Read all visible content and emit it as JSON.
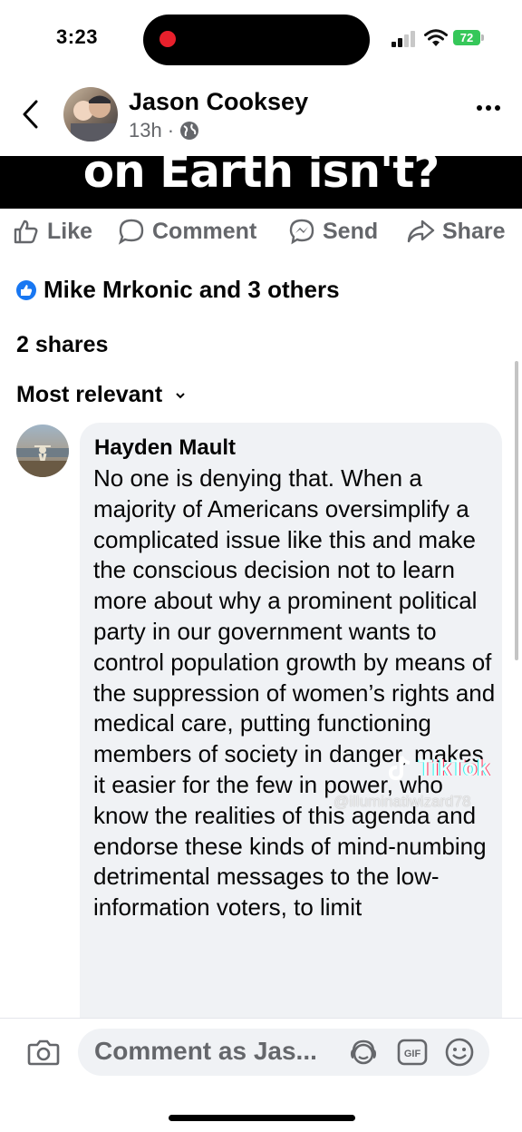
{
  "status_bar": {
    "time": "3:23",
    "battery": "72"
  },
  "header": {
    "author": "Jason Cooksey",
    "time_ago": "13h",
    "separator": "·"
  },
  "post_image": {
    "caption": "on Earth isn't?"
  },
  "actions": {
    "like": "Like",
    "comment": "Comment",
    "send": "Send",
    "share": "Share"
  },
  "engagement": {
    "reactions": "Mike Mrkonic and 3 others",
    "shares": "2 shares"
  },
  "sort": {
    "label": "Most relevant"
  },
  "comment": {
    "author": "Hayden Mault",
    "text": "No one is denying that. When a majority of Americans oversimplify a complicated issue like this and make the conscious decision not to learn more about why a prominent political party in our government wants to control population growth by means of the suppression of women’s rights and medical care, putting functioning members of society in danger, makes it easier for the few in power, who know the realities of this agenda and endorse these kinds of mind-numbing detrimental messages to the low-information voters, to limit"
  },
  "watermark": {
    "brand": "TikTok",
    "user": "@illuminatiwizard78"
  },
  "composer": {
    "placeholder": "Comment as Jas..."
  },
  "colors": {
    "brand_blue": "#1877f2",
    "muted": "#65676b",
    "bubble": "#f0f2f5",
    "battery": "#35c759",
    "record": "#e8202c"
  },
  "icons": [
    "back-arrow-icon",
    "globe-icon",
    "more-icon",
    "like-icon",
    "comment-icon",
    "messenger-icon",
    "share-icon",
    "thumbs-up-badge-icon",
    "chevron-down-icon",
    "camera-icon",
    "avatar-sticker-icon",
    "gif-icon",
    "emoji-icon"
  ]
}
